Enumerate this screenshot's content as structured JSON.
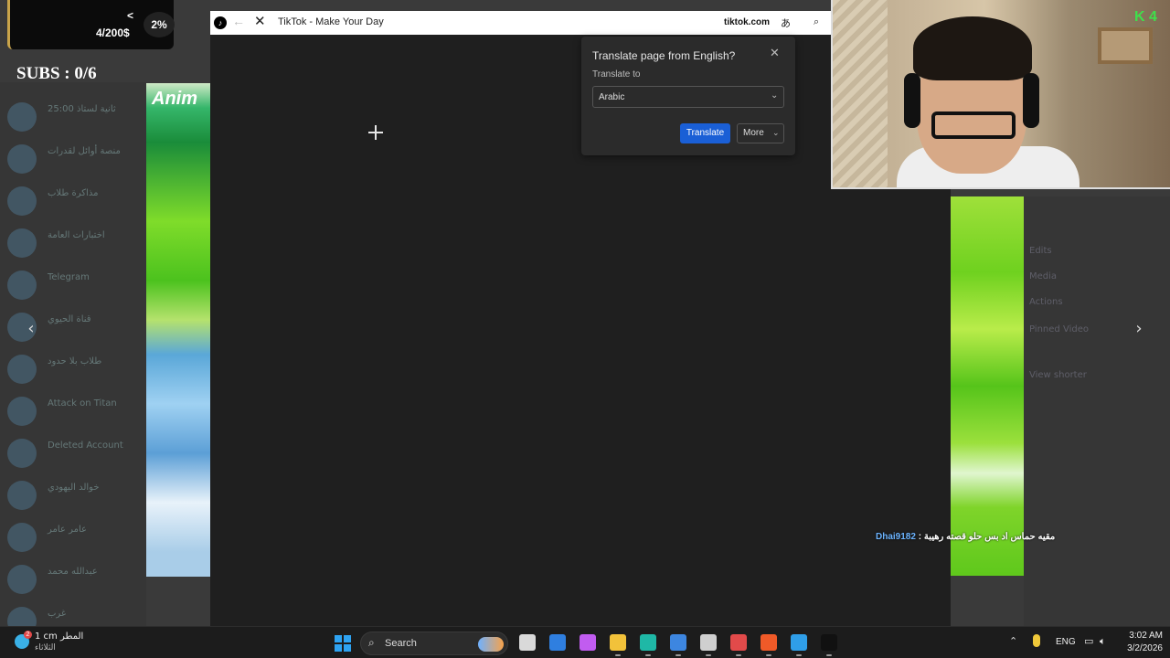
{
  "overlay": {
    "goal_arrow": "<",
    "goal_amount": "4/200$",
    "goal_percent": "2%",
    "subs": "SUBS : 0/6",
    "cam_badge": "K 4"
  },
  "background_list": [
    {
      "name": "ثانية لستاذ 25:00"
    },
    {
      "name": "منصة أوائل لقدرات"
    },
    {
      "name": "مذاكرة طلاب"
    },
    {
      "name": "اختبارات العامة"
    },
    {
      "name": "Telegram"
    },
    {
      "name": "قناة الحيوي"
    },
    {
      "name": "طلاب بلا حدود"
    },
    {
      "name": "Attack on Titan"
    },
    {
      "name": "Deleted Account"
    },
    {
      "name": "خوالد اليهودي"
    },
    {
      "name": "عامر عامر"
    },
    {
      "name": "عبدالله محمد"
    },
    {
      "name": "غرب"
    }
  ],
  "background_right": [
    {
      "text": "Edits"
    },
    {
      "text": "Media"
    },
    {
      "text": "Actions"
    },
    {
      "text": "Pinned Video"
    },
    {
      "text": "View shorter"
    }
  ],
  "browser": {
    "title": "TikTok - Make Your Day",
    "domain": "tiktok.com"
  },
  "translate_popup": {
    "title": "Translate page from English?",
    "label": "Translate to",
    "selected_language": "Arabic",
    "translate_button": "Translate",
    "more_button": "More"
  },
  "chat": {
    "user": "Dhai9182",
    "separator": " : ",
    "message": "مقيه حماس اد بس حلو قصته رهيبة"
  },
  "taskbar": {
    "weather_line1": "1 cm المطر",
    "weather_line2": "الثلاثاء",
    "weather_badge": "2",
    "search_label": "Search",
    "language": "ENG",
    "time": "3:02 AM",
    "date": "3/2/2026",
    "apps": [
      {
        "icon": "task-view-icon",
        "color": "#d9d9d9"
      },
      {
        "icon": "mail-icon",
        "color": "#2f7fe0"
      },
      {
        "icon": "copilot-icon",
        "color": "#c15cf0"
      },
      {
        "icon": "file-explorer-icon",
        "color": "#f2c23a"
      },
      {
        "icon": "edge-icon",
        "color": "#1fb8a6"
      },
      {
        "icon": "store-icon",
        "color": "#3d86e0"
      },
      {
        "icon": "settings-icon",
        "color": "#cfcfcf"
      },
      {
        "icon": "chrome-icon",
        "color": "#e24a4a"
      },
      {
        "icon": "brave-icon",
        "color": "#f05a28"
      },
      {
        "icon": "photos-icon",
        "color": "#2f9ee8"
      },
      {
        "icon": "tiktok-icon",
        "color": "#111111"
      }
    ]
  }
}
